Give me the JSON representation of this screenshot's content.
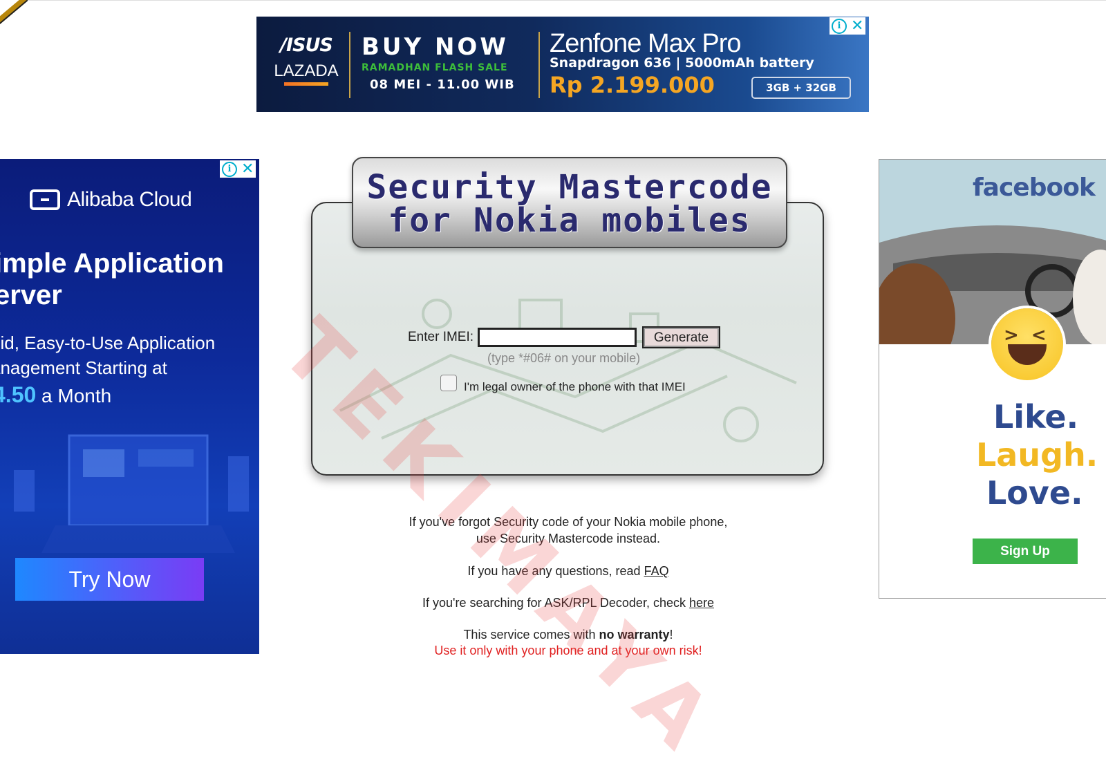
{
  "banner_ad": {
    "brand1": "/ISUS",
    "brand2": "LAZADA",
    "headline": "BUY NOW",
    "sale": "RAMADHAN FLASH SALE",
    "date": "08 MEI - 11.00 WIB",
    "model": "Zenfone Max Pro",
    "spec": "Snapdragon 636 | 5000mAh battery",
    "price": "Rp 2.199.000",
    "promo": "3GB + 32GB"
  },
  "left_ad": {
    "brand": "Alibaba Cloud",
    "headline": "imple Application\nerver",
    "body": "pid, Easy-to-Use Application\nanagement Starting at",
    "price_value": "4.50",
    "price_suffix": " a Month",
    "cta": "Try Now"
  },
  "right_ad": {
    "brand": "facebook",
    "line1": "Like.",
    "line2": "Laugh.",
    "line3": "Love.",
    "cta": "Sign Up"
  },
  "main": {
    "title_line1": "Security Mastercode",
    "title_line2": "for Nokia mobiles",
    "imei_label": "Enter IMEI:",
    "imei_value": "",
    "generate_label": "Generate",
    "hint": "(type *#06# on your mobile)",
    "legal_label": "I'm legal owner of the phone with that IMEI"
  },
  "info": {
    "p1_line1": "If you've forgot Security code of your Nokia mobile phone,",
    "p1_line2": "use Security Mastercode instead.",
    "p2_prefix": "If you have any questions, read ",
    "p2_link": "FAQ",
    "p3_prefix": "If you're searching for ASK/RPL Decoder, check ",
    "p3_link": "here",
    "p4_prefix": "This service comes with ",
    "p4_bold": "no warranty",
    "p4_suffix": "!",
    "p5_warning": "Use it only with your phone and at your own risk!"
  },
  "watermark": "TEKIMAYA",
  "icons": {
    "adchoices": "info-icon",
    "close": "close-icon"
  }
}
